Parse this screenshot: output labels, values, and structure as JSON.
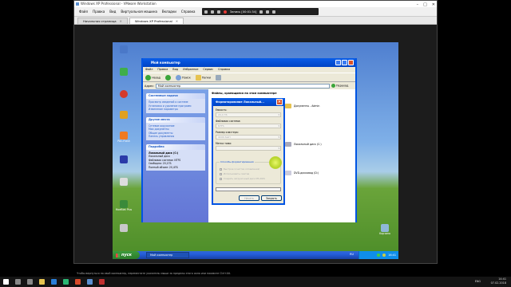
{
  "host": {
    "window_title": "Windows XP Professional - VMware Workstation",
    "menu": [
      "Файл",
      "Правка",
      "Вид",
      "Виртуальная машина",
      "Вкладки",
      "Справка"
    ],
    "rec_text": "Запись [00:01:34]",
    "tabs": [
      {
        "label": "Начальная страница"
      },
      {
        "label": "Windows XP Professional"
      }
    ],
    "notice": "Чтобы вернуться на свой компьютер, переместите указатель мыши за пределы этого окна или нажмите Ctrl+Alt.",
    "clock_time": "14:41",
    "clock_date": "07.02.2018",
    "lang": "ENG"
  },
  "xp": {
    "desktop_icons": [
      "",
      "",
      "",
      "",
      "PAC-Flash",
      "",
      "",
      "MoeBlat Plus",
      ""
    ],
    "recycle": "Корзина",
    "taskbar": {
      "start": "пуск",
      "window_button": "Мой компьютер",
      "lang": "RU",
      "time": "16:41"
    }
  },
  "mycomputer": {
    "title": "Мой компьютер",
    "menu": [
      "Файл",
      "Правка",
      "Вид",
      "Избранное",
      "Сервис",
      "Справка"
    ],
    "toolbar": {
      "back": "Назад",
      "search": "Поиск",
      "folders": "Папки"
    },
    "address_label": "Адрес:",
    "address_value": "Мой компьютер",
    "go": "Переход",
    "content_header": "Файлы, хранящиеся на этом компьютере",
    "system_tasks": {
      "title": "Системные задачи",
      "items": [
        "Просмотр сведений о системе",
        "Установка и удаление программ",
        "Изменение параметра"
      ]
    },
    "other_places": {
      "title": "Другие места",
      "items": [
        "Сетевое окружение",
        "Мои документы",
        "Общие документы",
        "Панель управления"
      ]
    },
    "details": {
      "title": "Подробно",
      "name": "Локальный диск (C:)",
      "type": "Локальный диск",
      "fs": "Файловая система: NTFS",
      "free": "Свободно: 20,1ГБ",
      "total": "Полный объем: 20,4ГБ"
    },
    "drives": [
      {
        "label": "Документы - Admin"
      },
      {
        "label": "Локальный диск (C:)"
      },
      {
        "label": "DVD-дисковод (D:)"
      }
    ]
  },
  "format_dialog": {
    "title": "Форматирование Локальный...",
    "capacity_label": "Емкость:",
    "capacity_value": "20,4 ГБ",
    "fs_label": "Файловая система:",
    "fs_value": "NTFS",
    "cluster_label": "Размер кластера:",
    "cluster_value": "4096 байт",
    "volume_label": "Метка тома:",
    "options_label": "Способы форматирования",
    "opt1": "Быстрое (очистка оглавления)",
    "opt2": "Использовать сжатие",
    "opt3": "Создать загрузочный диск MS-DOS",
    "start_button": "Начать",
    "close_button": "Закрыть"
  }
}
